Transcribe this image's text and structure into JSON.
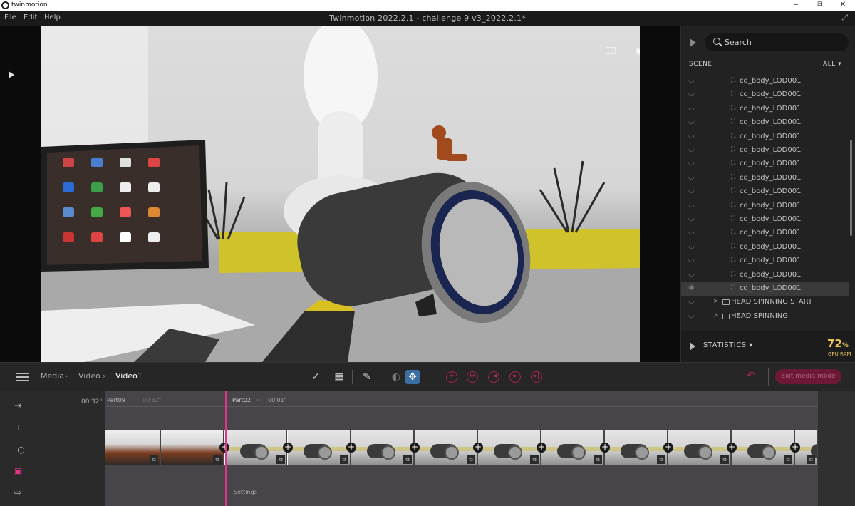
{
  "os_window": {
    "title": "twinmotion",
    "minimize": "‒",
    "restore": "⧉",
    "close": "✕"
  },
  "menu": {
    "file": "File",
    "edit": "Edit",
    "help": "Help"
  },
  "document_title": "Twinmotion 2022.2.1 - challenge 9 v3_2022.2.1*",
  "right_panel": {
    "search_placeholder": "Search",
    "scene_label": "SCENE",
    "filter_label": "ALL",
    "tree": [
      {
        "name": "cd_body_LOD001"
      },
      {
        "name": "cd_body_LOD001"
      },
      {
        "name": "cd_body_LOD001"
      },
      {
        "name": "cd_body_LOD001"
      },
      {
        "name": "cd_body_LOD001"
      },
      {
        "name": "cd_body_LOD001"
      },
      {
        "name": "cd_body_LOD001"
      },
      {
        "name": "cd_body_LOD001"
      },
      {
        "name": "cd_body_LOD001"
      },
      {
        "name": "cd_body_LOD001"
      },
      {
        "name": "cd_body_LOD001"
      },
      {
        "name": "cd_body_LOD001"
      },
      {
        "name": "cd_body_LOD001"
      },
      {
        "name": "cd_body_LOD001"
      },
      {
        "name": "cd_body_LOD001"
      },
      {
        "name": "cd_body_LOD001"
      },
      {
        "name": "HEAD SPINNING START"
      },
      {
        "name": "HEAD SPINNING"
      }
    ],
    "statistics_label": "STATISTICS",
    "gpu_value": "72",
    "gpu_unit": "%",
    "gpu_label": "GPU RAM"
  },
  "timeline": {
    "breadcrumb": [
      "Media",
      "Video",
      "Video1"
    ],
    "exit_label": "Exit media mode",
    "time_label": "00'32\"",
    "part1_name": "Part09",
    "part1_time": "00'32\"",
    "part2_name": "Part02",
    "part2_dots": "···",
    "part2_time": "00'01\"",
    "settings_label": "Settings"
  },
  "colors": {
    "accent": "#e0338a",
    "exit_button": "#6e1838",
    "gpu_value": "#e8c65a"
  }
}
